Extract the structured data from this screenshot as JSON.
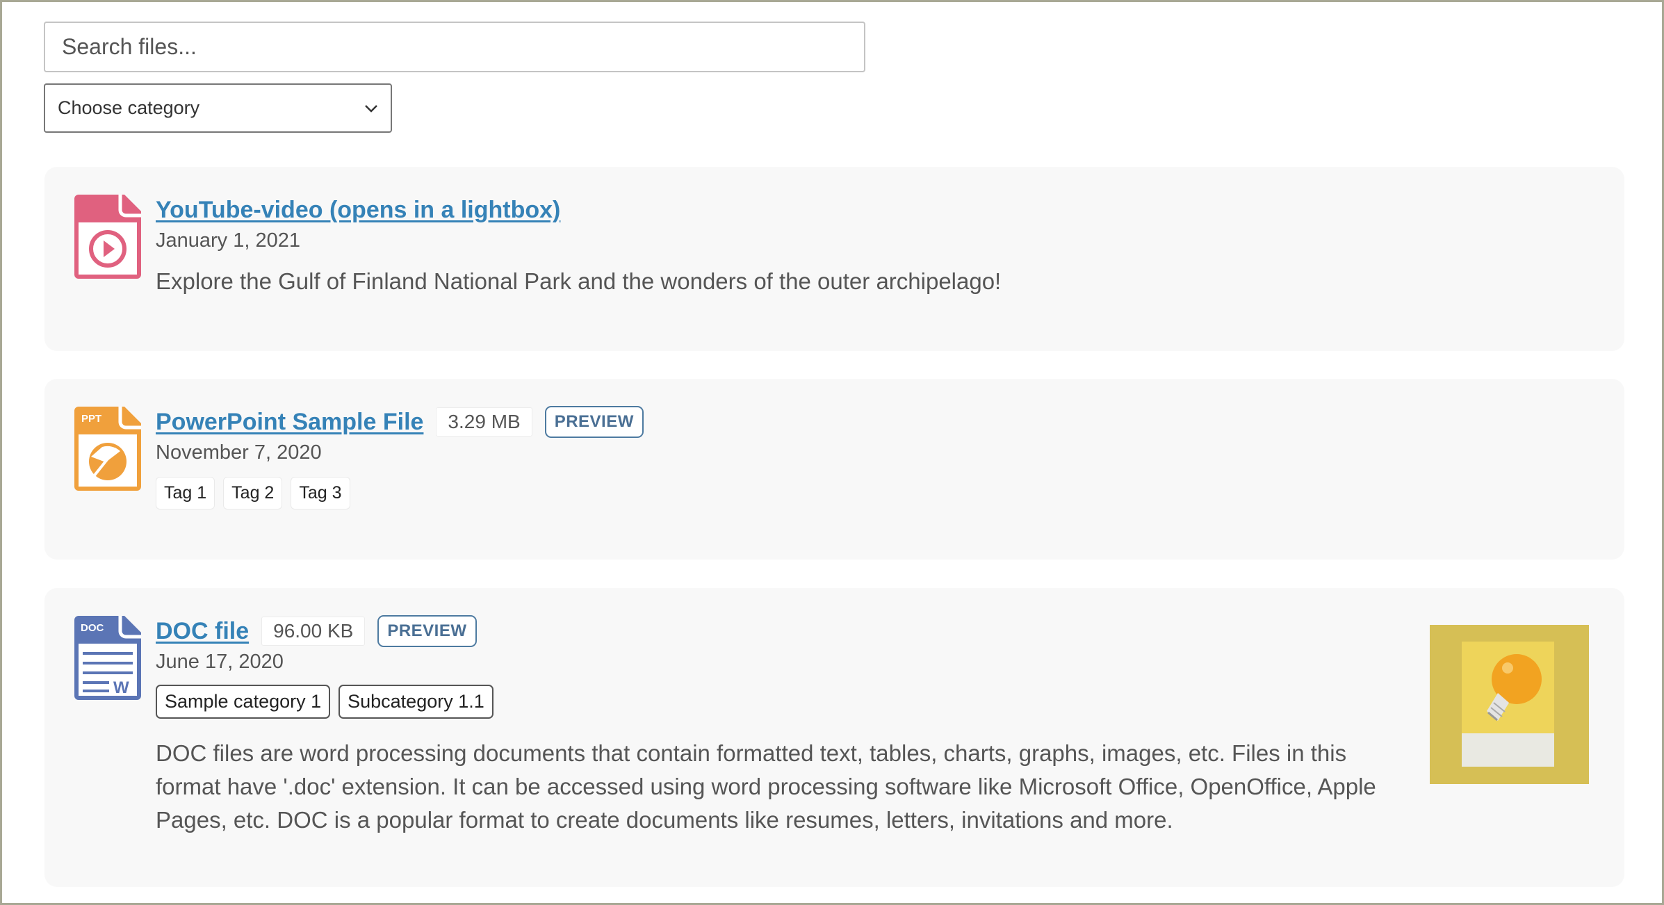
{
  "search": {
    "placeholder": "Search files..."
  },
  "category_select": {
    "selected": "Choose category"
  },
  "files": [
    {
      "type": "video",
      "icon": "video-file-icon",
      "icon_color": "#e0617f",
      "title": "YouTube-video (opens in a lightbox)",
      "date": "January 1, 2021",
      "description": "Explore the Gulf of Finland National Park and the wonders of the outer archipelago!"
    },
    {
      "type": "ppt",
      "icon": "ppt-file-icon",
      "icon_label": "PPT",
      "icon_color": "#f0a03c",
      "title": "PowerPoint Sample File",
      "size": "3.29 MB",
      "preview_label": "PREVIEW",
      "date": "November 7, 2020",
      "tags": [
        "Tag 1",
        "Tag 2",
        "Tag 3"
      ]
    },
    {
      "type": "doc",
      "icon": "doc-file-icon",
      "icon_label": "DOC",
      "icon_letter": "W",
      "icon_color": "#5b75b5",
      "title": "DOC file",
      "size": "96.00 KB",
      "preview_label": "PREVIEW",
      "date": "June 17, 2020",
      "categories": [
        "Sample category 1",
        "Subcategory 1.1"
      ],
      "description": "DOC files are word processing documents that contain formatted text, tables, charts, graphs, images, etc. Files in this format have '.doc' extension. It can be accessed using word processing software like Microsoft Office, OpenOffice, Apple Pages, etc. DOC is a popular format to create documents like resumes, letters, invitations and more.",
      "thumbnail": "lightbulb-image"
    }
  ],
  "colors": {
    "link": "#3582b7",
    "preview": "#4a6f94",
    "card_bg": "#f8f8f8"
  }
}
